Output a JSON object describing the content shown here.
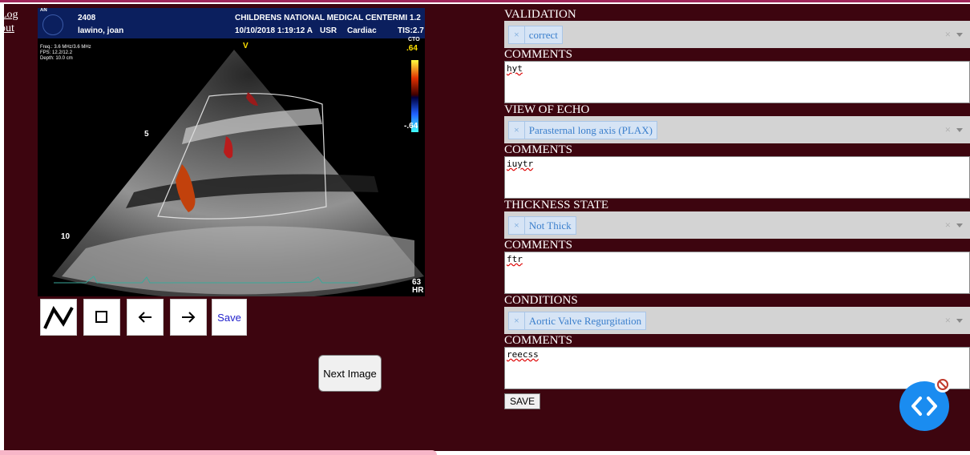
{
  "nav": {
    "logout_label": "Log out"
  },
  "echo_image": {
    "header": {
      "id_number": "2408",
      "patient_name": "lawino, joan",
      "hospital": "CHILDRENS NATIONAL MEDICAL CENTER",
      "mi": "MI 1.2",
      "datetime": "10/10/2018 1:19:12 A",
      "user": "USR",
      "mode": "Cardiac",
      "tis": "TIS:2.7"
    },
    "badge": "AN",
    "params": "Freq.: 3.6 MHz/3.6 MHz\nFPS: 12.2/12.2\nDepth: 10.0 cm",
    "probe_marker": "V",
    "cto_label": "CTO",
    "scale_top": ".64",
    "scale_bottom": "-.64",
    "depth_5": "5",
    "depth_10": "10",
    "hr_value": "63",
    "hr_label": "HR"
  },
  "toolbar": {
    "save_label": "Save",
    "next_image_label": "Next Image"
  },
  "form": {
    "sections": [
      {
        "label": "VALIDATION",
        "tag": "correct",
        "comments_label": "COMMENTS",
        "comment": "hyt"
      },
      {
        "label": "VIEW OF ECHO",
        "tag": "Parasternal long axis (PLAX)",
        "comments_label": "COMMENTS",
        "comment": "iuytr"
      },
      {
        "label": "THICKNESS STATE",
        "tag": "Not Thick",
        "comments_label": "COMMENTS",
        "comment": "ftr"
      },
      {
        "label": "CONDITIONS",
        "tag": "Aortic Valve Regurgitation",
        "comments_label": "COMMENTS",
        "comment": "reecss"
      }
    ],
    "save_label": "SAVE"
  },
  "colors": {
    "page_bg": "#3d050f",
    "accent_line": "#a0265a",
    "tag_text": "#3b7fcc",
    "fab": "#1a8cf0"
  }
}
